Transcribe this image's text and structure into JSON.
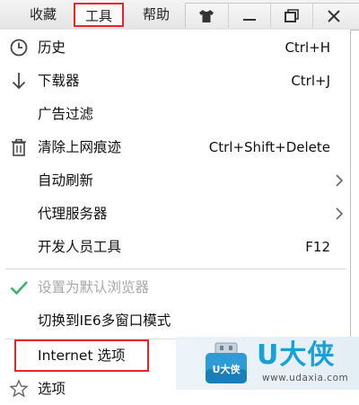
{
  "menubar": {
    "favorites": "收藏",
    "tools": "工具",
    "help": "帮助",
    "window_buttons": [
      "skin-icon",
      "minimize-icon",
      "restore-icon",
      "close-icon"
    ]
  },
  "dropdown": {
    "items": [
      {
        "icon": "clock-icon",
        "label": "历史",
        "shortcut": "Ctrl+H"
      },
      {
        "icon": "download-arrow-icon",
        "label": "下载器",
        "shortcut": "Ctrl+J"
      },
      {
        "icon": "",
        "label": "广告过滤",
        "shortcut": ""
      },
      {
        "icon": "trash-icon",
        "label": "清除上网痕迹",
        "shortcut": "Ctrl+Shift+Delete"
      },
      {
        "icon": "",
        "label": "自动刷新",
        "shortcut": "",
        "submenu": true
      },
      {
        "icon": "",
        "label": "代理服务器",
        "shortcut": "",
        "submenu": true
      },
      {
        "icon": "",
        "label": "开发人员工具",
        "shortcut": "F12"
      },
      {
        "icon": "checkmark-icon",
        "label": "设置为默认浏览器",
        "shortcut": "",
        "disabled": true
      },
      {
        "icon": "",
        "label": "切换到IE6多窗口模式",
        "shortcut": ""
      },
      {
        "icon": "",
        "label": "Internet 选项",
        "shortcut": "",
        "highlighted": true
      },
      {
        "icon": "star-icon",
        "label": "选项",
        "shortcut": ""
      }
    ]
  },
  "colors": {
    "highlight_border": "#e8262a",
    "checkmark": "#3cb371",
    "watermark_brand": "#1aa0d8"
  },
  "watermark": {
    "logo_label": "U大侠",
    "brand": "U大侠",
    "url": "www.udaxia.com"
  }
}
